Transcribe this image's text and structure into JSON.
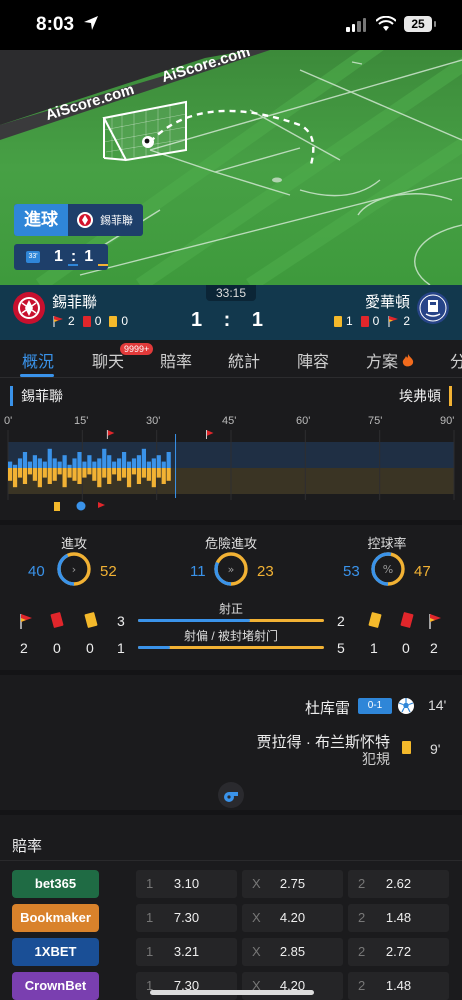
{
  "status": {
    "time": "8:03",
    "battery": "25"
  },
  "pitch": {
    "banner_text": "AiScore.com",
    "banner_text2": "AiScore.com",
    "goal_label": "進球",
    "goal_team": "錫菲聯",
    "mini_minute": "33'",
    "mini_home": "1",
    "mini_sep": ":",
    "mini_away": "1"
  },
  "match": {
    "clock": "33:15",
    "home": {
      "name": "錫菲聯",
      "corners": "2",
      "red": "0",
      "yellow": "0"
    },
    "away": {
      "name": "愛華頓",
      "yellow": "1",
      "red": "0",
      "corners": "2"
    },
    "score": "1 : 1"
  },
  "tabs": [
    {
      "label": "概況"
    },
    {
      "label": "聊天"
    },
    {
      "label": "賠率"
    },
    {
      "label": "統計"
    },
    {
      "label": "陣容"
    },
    {
      "label": "方案"
    },
    {
      "label": "分"
    }
  ],
  "chat_badge": "9999+",
  "timeline": {
    "home_team": "錫菲聯",
    "away_team": "埃弗頓",
    "ticks": [
      "0'",
      "15'",
      "30'",
      "45'",
      "60'",
      "75'",
      "90'"
    ],
    "current_minute": 33,
    "home_bars": [
      2,
      1,
      3,
      5,
      2,
      4,
      3,
      2,
      6,
      3,
      2,
      4,
      1,
      3,
      5,
      2,
      4,
      2,
      3,
      6,
      4,
      2,
      3,
      5,
      2,
      3,
      4,
      6,
      2,
      3,
      4,
      2,
      5
    ],
    "away_bars": [
      4,
      6,
      3,
      5,
      2,
      4,
      6,
      3,
      5,
      4,
      2,
      6,
      3,
      4,
      5,
      3,
      2,
      4,
      6,
      3,
      5,
      2,
      4,
      3,
      6,
      2,
      5,
      3,
      4,
      6,
      3,
      5,
      4
    ]
  },
  "stats": {
    "attack": {
      "title": "進攻",
      "home": "40",
      "away": "52",
      "home_pct": 0.43
    },
    "danger": {
      "title": "危險進攻",
      "home": "11",
      "away": "23",
      "home_pct": 0.32
    },
    "possession": {
      "title": "控球率",
      "home": "53",
      "away": "47",
      "home_pct": 0.53
    },
    "on_target": {
      "title": "射正",
      "home": "3",
      "away": "2",
      "home_pct": 0.6
    },
    "off_target": {
      "title": "射偏 / 被封堵射门",
      "home": "1",
      "away": "5",
      "home_pct": 0.17
    },
    "home_corners": "2",
    "home_red": "0",
    "home_yellow": "0",
    "away_yellow": "1",
    "away_red": "0",
    "away_corners": "2"
  },
  "events": [
    {
      "player": "杜库雷",
      "score": "0-1",
      "minute": "14'"
    },
    {
      "player": "贾拉得 · 布兰斯怀特",
      "detail": "犯規",
      "minute": "9'"
    }
  ],
  "odds": {
    "title": "賠率",
    "rows": [
      {
        "bookmaker": "bet365",
        "color": "#1f6b44",
        "k1": "1",
        "v1": "3.10",
        "kx": "X",
        "vx": "2.75",
        "k2": "2",
        "v2": "2.62"
      },
      {
        "bookmaker": "Bookmaker",
        "color": "#d9822b",
        "k1": "1",
        "v1": "7.30",
        "kx": "X",
        "vx": "4.20",
        "k2": "2",
        "v2": "1.48"
      },
      {
        "bookmaker": "1XBET",
        "color": "#1a4f96",
        "k1": "1",
        "v1": "3.21",
        "kx": "X",
        "vx": "2.85",
        "k2": "2",
        "v2": "2.72"
      },
      {
        "bookmaker": "CrownBet",
        "color": "#7a3fb0",
        "k1": "1",
        "v1": "7.30",
        "kx": "X",
        "vx": "4.20",
        "k2": "2",
        "v2": "1.48"
      }
    ]
  }
}
